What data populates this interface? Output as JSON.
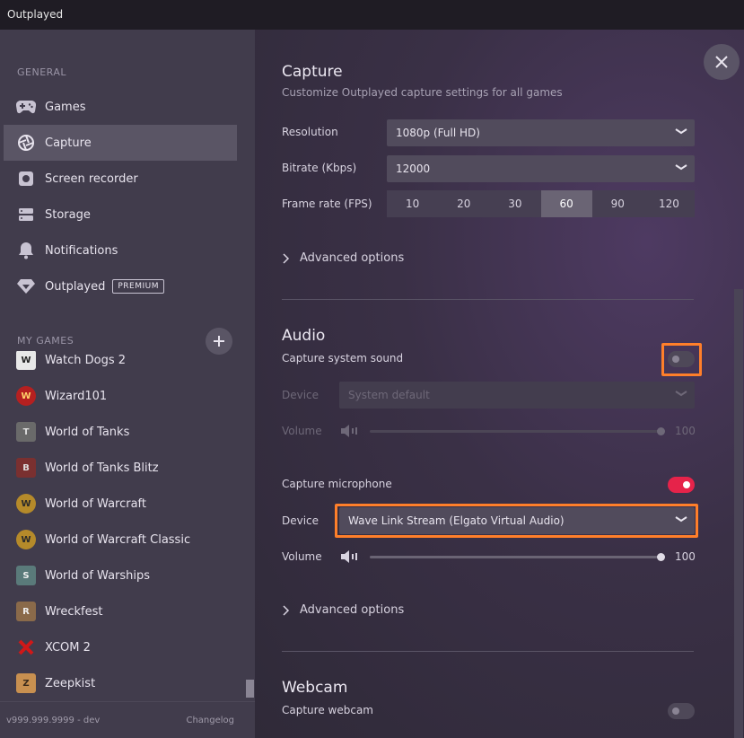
{
  "window": {
    "title": "Outplayed"
  },
  "sidebar": {
    "general_label": "GENERAL",
    "items": [
      {
        "label": "Games",
        "icon": "gamepad-icon"
      },
      {
        "label": "Capture",
        "icon": "aperture-icon",
        "active": true
      },
      {
        "label": "Screen recorder",
        "icon": "record-icon"
      },
      {
        "label": "Storage",
        "icon": "storage-icon"
      },
      {
        "label": "Notifications",
        "icon": "bell-icon"
      },
      {
        "label": "Outplayed",
        "icon": "outplayed-logo-icon",
        "badge": "PREMIUM"
      }
    ],
    "my_games_label": "MY GAMES",
    "games": [
      {
        "label": "Watch Dogs 2"
      },
      {
        "label": "Wizard101"
      },
      {
        "label": "World of Tanks"
      },
      {
        "label": "World of Tanks Blitz"
      },
      {
        "label": "World of Warcraft"
      },
      {
        "label": "World of Warcraft Classic"
      },
      {
        "label": "World of Warships"
      },
      {
        "label": "Wreckfest"
      },
      {
        "label": "XCOM 2"
      },
      {
        "label": "Zeepkist"
      }
    ],
    "version": "v999.999.9999 - dev",
    "changelog": "Changelog"
  },
  "capture": {
    "title": "Capture",
    "subtitle": "Customize Outplayed capture settings for all games",
    "resolution_label": "Resolution",
    "resolution_value": "1080p (Full HD)",
    "bitrate_label": "Bitrate (Kbps)",
    "bitrate_value": "12000",
    "framerate_label": "Frame rate (FPS)",
    "framerate_options": [
      "10",
      "20",
      "30",
      "60",
      "90",
      "120"
    ],
    "framerate_selected": "60",
    "advanced_label": "Advanced options"
  },
  "audio": {
    "title": "Audio",
    "system_sound_label": "Capture system sound",
    "system_sound_enabled": false,
    "system_device_label": "Device",
    "system_device_value": "System default",
    "system_volume_label": "Volume",
    "system_volume_value": "100",
    "mic_label": "Capture microphone",
    "mic_enabled": true,
    "mic_device_label": "Device",
    "mic_device_value": "Wave Link Stream (Elgato Virtual Audio)",
    "mic_volume_label": "Volume",
    "mic_volume_value": "100",
    "advanced_label": "Advanced options"
  },
  "webcam": {
    "title": "Webcam",
    "capture_label": "Capture webcam",
    "capture_enabled": false
  },
  "colors": {
    "accent": "#e6234a",
    "highlight": "#ff7f2a"
  }
}
